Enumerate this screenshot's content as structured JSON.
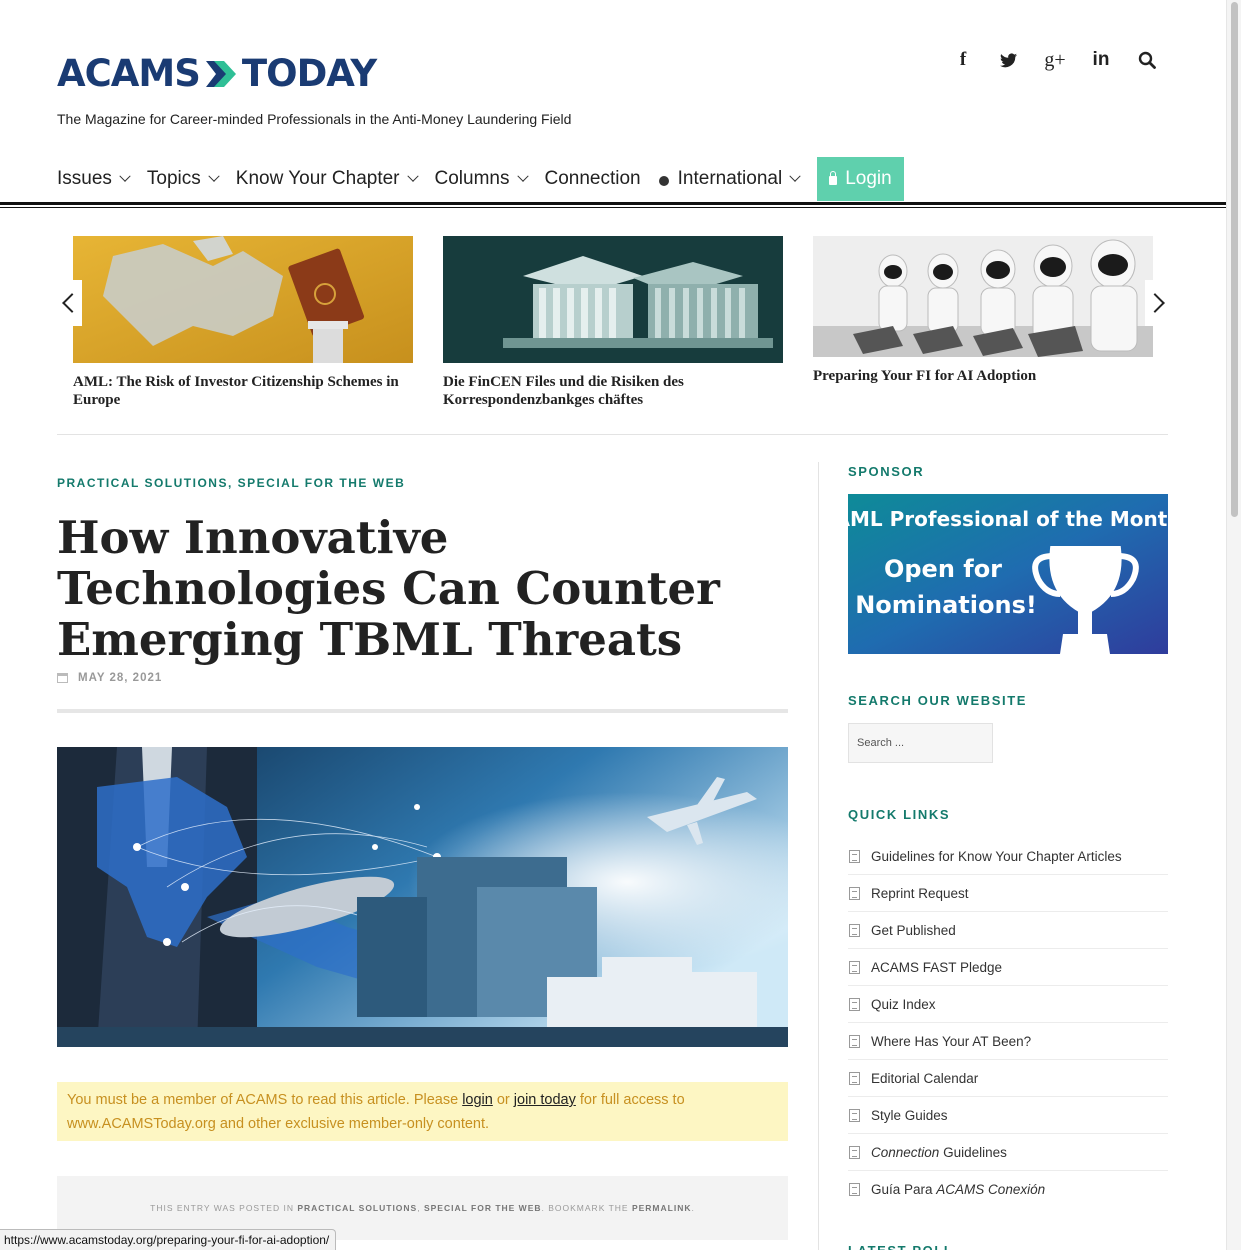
{
  "header": {
    "logo_left": "ACAMS",
    "logo_right": "TODAY",
    "tagline": "The Magazine for Career-minded Professionals in the Anti-Money Laundering Field",
    "social_icons": [
      "facebook-icon",
      "twitter-icon",
      "google-plus-icon",
      "linkedin-icon",
      "search-icon"
    ],
    "social_glyphs": [
      "f",
      "t",
      "g+",
      "in",
      "⚲"
    ]
  },
  "nav": {
    "items": [
      "Issues",
      "Topics",
      "Know Your Chapter",
      "Columns",
      "Connection",
      "International"
    ],
    "login": "Login"
  },
  "carousel": {
    "slides": [
      {
        "caption": "AML: The Risk of Investor Citizenship Schemes in Europe"
      },
      {
        "caption": "Die FinCEN Files und die Risiken des Korrespondenzbankges chäftes"
      },
      {
        "caption": "Preparing Your FI for AI Adoption"
      }
    ]
  },
  "article": {
    "categories": [
      "PRACTICAL SOLUTIONS",
      "SPECIAL FOR THE WEB"
    ],
    "category_separator": ",",
    "title": "How Innovative Technologies Can Counter Emerging TBML Threats",
    "date": "MAY 28, 2021",
    "notice": {
      "before": "You must be a member of ACAMS to read this article. Please ",
      "login": "login",
      "or": " or ",
      "join": "join today",
      "after": " for full access to www.ACAMSToday.org and other exclusive member-only content."
    },
    "footer": {
      "prefix": "THIS ENTRY WAS POSTED IN ",
      "cat1": "PRACTICAL SOLUTIONS",
      "comma": ", ",
      "cat2": "SPECIAL FOR THE WEB",
      "mid": ". BOOKMARK THE ",
      "permalink": "PERMALINK",
      "end": "."
    }
  },
  "sidebar": {
    "sponsor_heading": "SPONSOR",
    "sponsor_title": "AML Professional of the Month",
    "sponsor_line1": "Open for",
    "sponsor_line2": "Nominations!",
    "search_heading": "SEARCH OUR WEBSITE",
    "search_placeholder": "Search ...",
    "quick_links_heading": "QUICK LINKS",
    "quick_links": [
      "Guidelines for Know Your Chapter Articles",
      "Reprint Request",
      "Get Published",
      "ACAMS FAST Pledge",
      "Quiz Index",
      "Where Has Your AT Been?",
      "Editorial Calendar",
      "Style Guides"
    ],
    "quick_link_connection": {
      "em": "Connection",
      "rest": " Guidelines"
    },
    "quick_link_guia": {
      "rest": "Guía Para ",
      "em": "ACAMS Conexión"
    },
    "next_heading": "LATEST POLL"
  },
  "status_url": "https://www.acamstoday.org/preparing-your-fi-for-ai-adoption/",
  "colors": {
    "accent": "#147a6c",
    "login": "#5fd0ad",
    "logo": "#1a3b73",
    "notice_bg": "#fdf6c3",
    "notice_text": "#c79020"
  }
}
